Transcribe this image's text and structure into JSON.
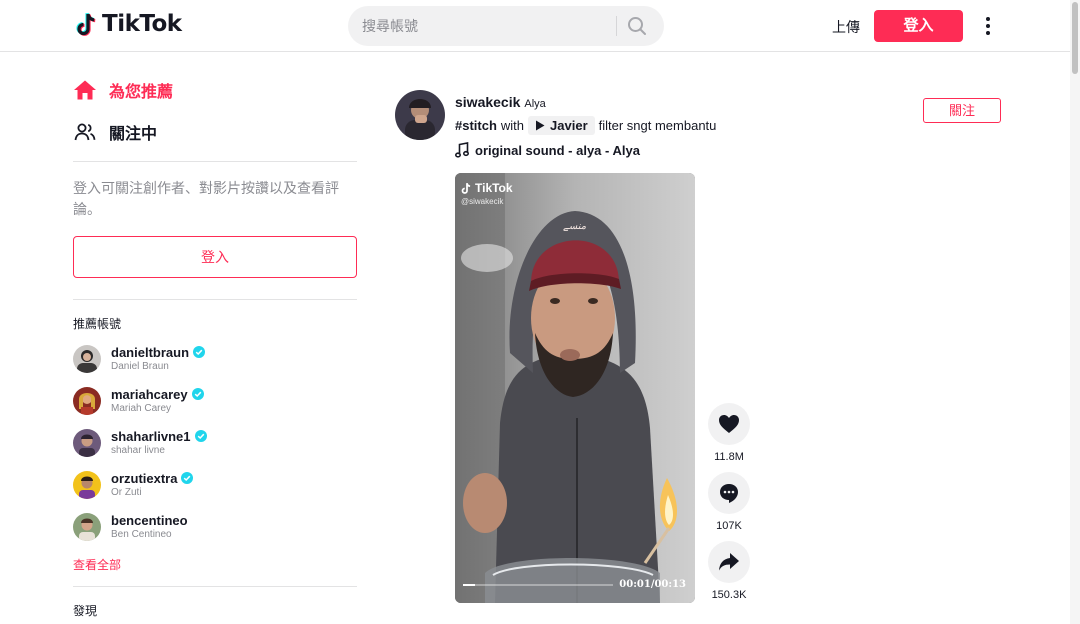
{
  "header": {
    "logo_text": "TikTok",
    "search_placeholder": "搜尋帳號",
    "upload_label": "上傳",
    "login_label": "登入"
  },
  "sidebar": {
    "nav": [
      {
        "label": "為您推薦",
        "icon": "home-icon",
        "active": true
      },
      {
        "label": "關注中",
        "icon": "users-icon",
        "active": false
      }
    ],
    "login_hint": "登入可關注創作者、對影片按讚以及查看評論。",
    "login_button": "登入",
    "suggested_title": "推薦帳號",
    "suggested_accounts": [
      {
        "username": "danieltbraun",
        "name": "Daniel Braun",
        "verified": true
      },
      {
        "username": "mariahcarey",
        "name": "Mariah Carey",
        "verified": true
      },
      {
        "username": "shaharlivne1",
        "name": "shahar livne",
        "verified": true
      },
      {
        "username": "orzutiextra",
        "name": "Or Zuti",
        "verified": true
      },
      {
        "username": "bencentineo",
        "name": "Ben Centineo",
        "verified": false
      }
    ],
    "see_all": "查看全部",
    "discover_title": "發現"
  },
  "post": {
    "username": "siwakecik",
    "nickname": "Alya",
    "hashtag": "#stitch",
    "caption_with": "with",
    "effect_name": "Javier",
    "caption_rest": "filter sngt membantu",
    "music": "original sound - alya - Alya",
    "follow_label": "關注",
    "video": {
      "watermark_logo": "TikTok",
      "watermark_handle": "@siwakecik",
      "time": "00:01/00:13",
      "progress": 0.077
    },
    "actions": {
      "likes": "11.8M",
      "comments": "107K",
      "shares": "150.3K"
    }
  },
  "colors": {
    "brand": "#fe2c55",
    "text": "#161823",
    "muted": "#8a8b91",
    "verified": "#20d5ec"
  }
}
